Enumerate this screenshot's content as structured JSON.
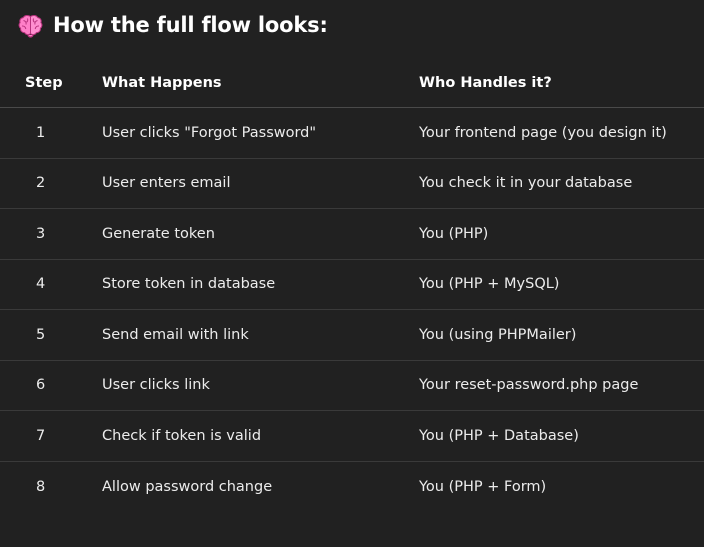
{
  "heading": {
    "icon": "brain-icon",
    "title": "How the full flow looks:"
  },
  "table": {
    "columns": [
      "Step",
      "What Happens",
      "Who Handles it?"
    ],
    "rows": [
      {
        "step": "1",
        "what": "User clicks \"Forgot Password\"",
        "who": "Your frontend page (you design it)"
      },
      {
        "step": "2",
        "what": "User enters email",
        "who": "You check it in your database"
      },
      {
        "step": "3",
        "what": "Generate token",
        "who": "You (PHP)"
      },
      {
        "step": "4",
        "what": "Store token in database",
        "who": "You (PHP + MySQL)"
      },
      {
        "step": "5",
        "what": "Send email with link",
        "who": "You (using PHPMailer)"
      },
      {
        "step": "6",
        "what": "User clicks link",
        "who": "Your reset-password.php page"
      },
      {
        "step": "7",
        "what": "Check if token is valid",
        "who": "You (PHP + Database)"
      },
      {
        "step": "8",
        "what": "Allow password change",
        "who": "You (PHP + Form)"
      }
    ]
  },
  "colors": {
    "background": "#212121",
    "text": "#ececec",
    "brain_pink": "#ff7fc8"
  }
}
